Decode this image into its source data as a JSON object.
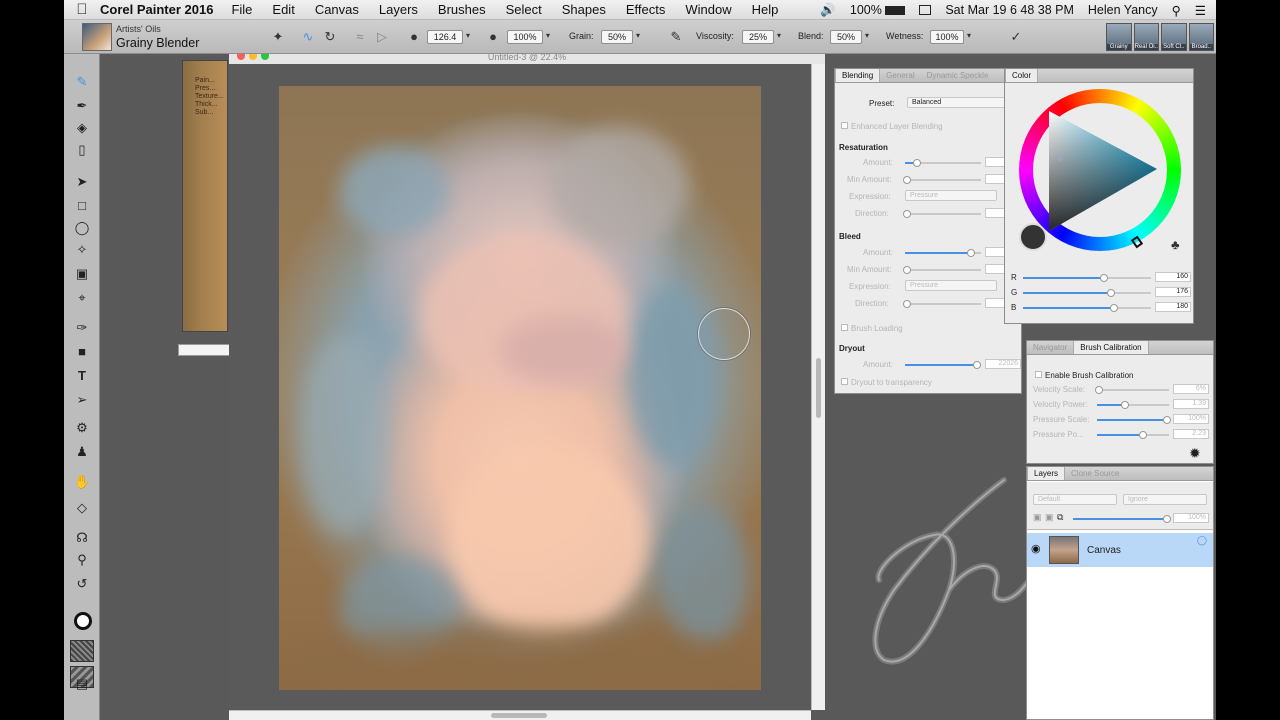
{
  "menubar": {
    "app_name": "Corel Painter 2016",
    "menus": [
      "File",
      "Edit",
      "Canvas",
      "Layers",
      "Brushes",
      "Select",
      "Shapes",
      "Effects",
      "Window",
      "Help"
    ],
    "battery": "100%",
    "datetime": "Sat Mar 19  6 48 38 PM",
    "user": "Helen Yancy"
  },
  "propbar": {
    "brush_category": "Artists' Oils",
    "brush_variant": "Grainy Blender",
    "size": "126.4",
    "opacity": "100%",
    "grain_label": "Grain:",
    "grain": "50%",
    "viscosity_label": "Viscosity:",
    "viscosity": "25%",
    "blend_label": "Blend:",
    "blend": "50%",
    "wetness_label": "Wetness:",
    "wetness": "100%",
    "recent_brushes": [
      "Grainy",
      "Real Oi..",
      "Soft Cl..",
      "Broad.."
    ]
  },
  "document": {
    "title": "Untitled-3 @ 22.4%",
    "bg_doc_text": "Pain... Pres... Texture... Thick... Sub..."
  },
  "brush_panel": {
    "tabs": [
      "Blending",
      "General",
      "Dynamic Speckle"
    ],
    "preset_label": "Preset:",
    "preset_value": "Balanced",
    "enhanced_label": "Enhanced Layer Blending",
    "resaturation": {
      "title": "Resaturation",
      "amount_label": "Amount:",
      "min_amount_label": "Min Amount:",
      "expression_label": "Expression:",
      "expression_value": "Pressure",
      "direction_label": "Direction:"
    },
    "bleed": {
      "title": "Bleed",
      "amount_label": "Amount:",
      "min_amount_label": "Min Amount:",
      "expression_label": "Expression:",
      "expression_value": "Pressure",
      "direction_label": "Direction:"
    },
    "brush_loading_label": "Brush Loading",
    "dryout": {
      "title": "Dryout",
      "amount_label": "Amount:",
      "amount_value": "22026"
    },
    "dryout_to_transparency": "Dryout to transparency"
  },
  "color_panel": {
    "title": "Color",
    "r_label": "R",
    "r": "160",
    "g_label": "G",
    "g": "176",
    "b_label": "B",
    "b": "180",
    "r_level": 0.63,
    "g_level": 0.69,
    "b_level": 0.71
  },
  "calibration_panel": {
    "tabs": [
      "Navigator",
      "Brush Calibration"
    ],
    "enable_label": "Enable Brush Calibration",
    "velocity_scale_label": "Velocity Scale:",
    "velocity_scale": "6%",
    "velocity_power_label": "Velocity Power:",
    "velocity_power": "1.39",
    "pressure_scale_label": "Pressure Scale:",
    "pressure_scale": "100%",
    "pressure_power_label": "Pressure Po...",
    "pressure_power": "2.23"
  },
  "layers_panel": {
    "tabs": [
      "Layers",
      "Clone Source"
    ],
    "composite_method": "Default",
    "composite_depth": "Ignore",
    "opacity": "100%",
    "layers": [
      {
        "name": "Canvas"
      }
    ]
  },
  "colors": {
    "accent": "#4a90e2",
    "layer_selected": "#b9d7f7"
  }
}
